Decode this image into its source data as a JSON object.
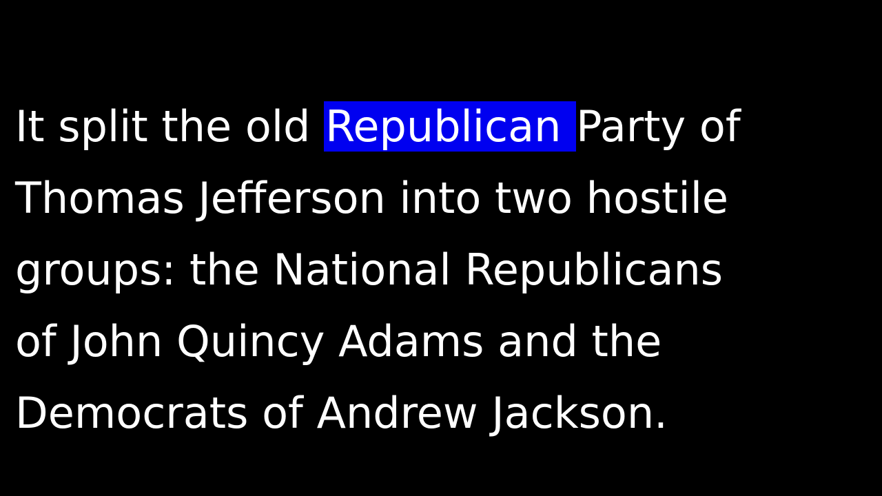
{
  "caption": {
    "line1_before": "It split the old ",
    "line1_highlight": "Republican ",
    "line1_after": "Party of",
    "line2": "Thomas Jefferson into two hostile",
    "line3": "groups: the National Republicans",
    "line4": "of John Quincy Adams and the",
    "line5": "Democrats of Andrew Jackson."
  },
  "colors": {
    "background": "#000000",
    "text": "#ffffff",
    "highlight": "#0000f0"
  }
}
